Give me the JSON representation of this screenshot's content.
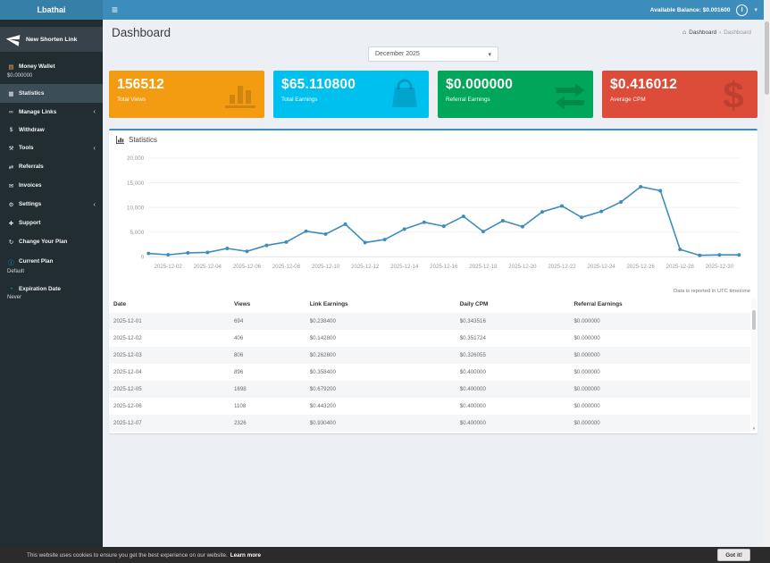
{
  "brand": "Lbathai",
  "topbar": {
    "balance_label": "Available Balance: $0.001600"
  },
  "sidebar": {
    "new_link_label": "New Shorten Link",
    "items": [
      {
        "id": "money-wallet",
        "icon": "wallet-icon",
        "glyph": "▤",
        "color": "#f0ad4e",
        "label": "Money Wallet",
        "sub": "$0.000000"
      },
      {
        "id": "statistics",
        "icon": "statistics-icon",
        "glyph": "▦",
        "label": "Statistics",
        "active": true
      },
      {
        "id": "manage-links",
        "icon": "link-icon",
        "glyph": "∞",
        "label": "Manage Links",
        "chevron": true
      },
      {
        "id": "withdraw",
        "icon": "dollar-icon",
        "glyph": "$",
        "label": "Withdraw"
      },
      {
        "id": "tools",
        "icon": "wrench-icon",
        "glyph": "⚒",
        "label": "Tools",
        "chevron": true
      },
      {
        "id": "referrals",
        "icon": "exchange-icon",
        "glyph": "⇄",
        "label": "Referrals"
      },
      {
        "id": "invoices",
        "icon": "envelope-icon",
        "glyph": "✉",
        "label": "Invoices"
      },
      {
        "id": "settings",
        "icon": "gears-icon",
        "glyph": "⚙",
        "label": "Settings",
        "chevron": true
      },
      {
        "id": "support",
        "icon": "support-icon",
        "glyph": "✚",
        "label": "Support"
      },
      {
        "id": "change-plan",
        "icon": "refresh-icon",
        "glyph": "↻",
        "label": "Change Your Plan"
      },
      {
        "id": "current-plan",
        "icon": "info-circle-icon",
        "glyph": "ⓘ",
        "color": "#00c0ef",
        "label": "Current Plan",
        "sub": "Default"
      },
      {
        "id": "expiration-date",
        "icon": "clock-icon",
        "glyph": "◔",
        "color": "#00c0ef",
        "label": "Expiration Date",
        "sub": "Never"
      }
    ]
  },
  "page": {
    "title": "Dashboard",
    "breadcrumb_home": "Dashboard",
    "breadcrumb_current": "Dashboard"
  },
  "filters": {
    "month_select": "December 2025"
  },
  "cards": [
    {
      "value": "156512",
      "label": "Total Views",
      "color": "#f39c12",
      "icon": "bar-chart-icon"
    },
    {
      "value": "$65.110800",
      "label": "Total Earnings",
      "color": "#00c0ef",
      "icon": "shopping-bag-icon"
    },
    {
      "value": "$0.000000",
      "label": "Referral Earnings",
      "color": "#00a65a",
      "icon": "exchange-arrows-icon"
    },
    {
      "value": "$0.416012",
      "label": "Average CPM",
      "color": "#dd4b39",
      "icon": "dollar-sign-icon"
    }
  ],
  "panel": {
    "title": "Statistics",
    "footnote": "Data is reported in UTC timezone"
  },
  "chart_data": {
    "type": "line",
    "title": "Statistics",
    "x": [
      "2025-12-01",
      "2025-12-02",
      "2025-12-03",
      "2025-12-04",
      "2025-12-05",
      "2025-12-06",
      "2025-12-07",
      "2025-12-08",
      "2025-12-09",
      "2025-12-10",
      "2025-12-11",
      "2025-12-12",
      "2025-12-13",
      "2025-12-14",
      "2025-12-15",
      "2025-12-16",
      "2025-12-17",
      "2025-12-18",
      "2025-12-19",
      "2025-12-20",
      "2025-12-21",
      "2025-12-22",
      "2025-12-23",
      "2025-12-24",
      "2025-12-25",
      "2025-12-26",
      "2025-12-27",
      "2025-12-28",
      "2025-12-29",
      "2025-12-30",
      "2025-12-31"
    ],
    "values": [
      694,
      406,
      806,
      896,
      1698,
      1108,
      2326,
      3000,
      5200,
      4600,
      6600,
      2900,
      3500,
      5600,
      7000,
      6200,
      8200,
      5100,
      7300,
      6100,
      9100,
      10300,
      8000,
      9200,
      11100,
      14200,
      13400,
      1500,
      300,
      400,
      400
    ],
    "ylim": [
      0,
      20000
    ],
    "yticks": [
      0,
      5000,
      10000,
      15000,
      20000
    ],
    "xtick_labels": [
      "2025-12-02",
      "2025-12-04",
      "2025-12-06",
      "2025-12-08",
      "2025-12-10",
      "2025-12-12",
      "2025-12-14",
      "2025-12-16",
      "2025-12-18",
      "2025-12-20",
      "2025-12-22",
      "2025-12-24",
      "2025-12-26",
      "2025-12-28",
      "2025-12-30"
    ],
    "xlabel": "",
    "ylabel": "",
    "line_color": "#3c8dbc",
    "grid": true,
    "legend": false
  },
  "table": {
    "columns": [
      "Date",
      "Views",
      "Link Earnings",
      "Daily CPM",
      "Referral Earnings"
    ],
    "col_widths": [
      "18.8%",
      "11.8%",
      "23.4%",
      "17.8%",
      "28.2%"
    ],
    "rows": [
      [
        "2025-12-01",
        "694",
        "$0.238400",
        "$0.343516",
        "$0.000000"
      ],
      [
        "2025-12-02",
        "406",
        "$0.142800",
        "$0.351724",
        "$0.000000"
      ],
      [
        "2025-12-03",
        "806",
        "$0.262800",
        "$0.326055",
        "$0.000000"
      ],
      [
        "2025-12-04",
        "896",
        "$0.358400",
        "$0.400000",
        "$0.000000"
      ],
      [
        "2025-12-05",
        "1698",
        "$0.679200",
        "$0.400000",
        "$0.000000"
      ],
      [
        "2025-12-06",
        "1108",
        "$0.443200",
        "$0.400000",
        "$0.000000"
      ],
      [
        "2025-12-07",
        "2326",
        "$0.930400",
        "$0.400000",
        "$0.000000"
      ]
    ]
  },
  "cookie_bar": {
    "message": "This website uses cookies to ensure you get the best experience on our website.",
    "link": "Learn more",
    "button": "Got it!"
  },
  "colors": {
    "navbar": "#3c8dbc",
    "logo_bg": "#367fa9",
    "sidebar_bg": "#222d32",
    "content_bg": "#ecf0f5",
    "card_orange": "#f39c12",
    "card_blue": "#00c0ef",
    "card_green": "#00a65a",
    "card_red": "#dd4b39"
  }
}
